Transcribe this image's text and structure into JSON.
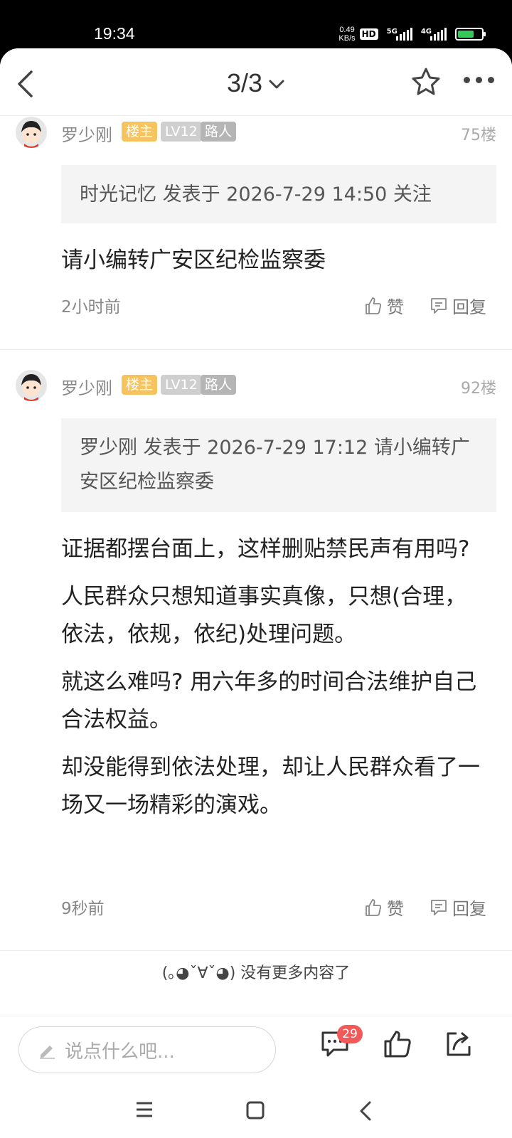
{
  "status": {
    "time": "19:34",
    "speed_value": "0.49",
    "speed_unit": "KB/s",
    "hd_label": "HD",
    "net1": "5G",
    "net2": "4G"
  },
  "nav": {
    "page_indicator": "3/3"
  },
  "posts": [
    {
      "username": "罗少刚",
      "host_badge": "楼主",
      "level_badge": "LV12",
      "role_badge": "路人",
      "floor": "75楼",
      "quote": "时光记忆 发表于 2026-7-29 14:50 关注",
      "content": [
        "请小编转广安区纪检监察委"
      ],
      "time_ago": "2小时前",
      "like_label": "赞",
      "reply_label": "回复"
    },
    {
      "username": "罗少刚",
      "host_badge": "楼主",
      "level_badge": "LV12",
      "role_badge": "路人",
      "floor": "92楼",
      "quote": "罗少刚 发表于 2026-7-29 17:12 请小编转广安区纪检监察委",
      "content": [
        "证据都摆台面上，这样删贴禁民声有用吗?",
        "人民群众只想知道事实真像，只想(合理，依法，依规，依纪)处理问题。",
        "就这么难吗? 用六年多的时间合法维护自己合法权益。",
        "却没能得到依法处理，却让人民群众看了一场又一场精彩的演戏。"
      ],
      "time_ago": "9秒前",
      "like_label": "赞",
      "reply_label": "回复"
    }
  ],
  "footer_note": "(｡◕ˇ∀ˇ◕) 没有更多内容了",
  "bottom_bar": {
    "input_placeholder": "说点什么吧...",
    "comment_count": "29"
  },
  "icons": {
    "back": "chevron-left-icon",
    "dropdown": "chevron-down-icon",
    "favorite": "star-icon",
    "more": "more-dots-icon",
    "like": "thumbs-up-icon",
    "reply": "comment-icon",
    "edit": "pencil-icon",
    "share": "share-icon"
  },
  "colors": {
    "host_badge": "#f7c35f",
    "level_badge": "#cfcfcf",
    "role_badge": "#b5b5b5",
    "count_badge": "#f25a5a"
  }
}
